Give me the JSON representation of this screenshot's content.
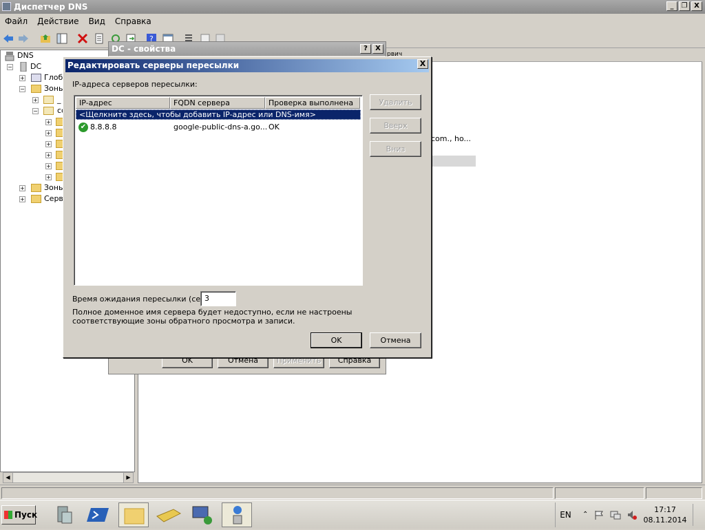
{
  "window": {
    "title": "Диспетчер DNS",
    "min": "_",
    "max": "❐",
    "close": "X"
  },
  "menu": [
    "Файл",
    "Действие",
    "Вид",
    "Справка"
  ],
  "tree": {
    "root": "DNS",
    "server": "DC",
    "items": [
      "Глоба",
      "Зоны",
      "_",
      "co",
      "Зоны",
      "Серве"
    ]
  },
  "right_pane": {
    "partial_text": "com., ho...",
    "header_partial": "рвич"
  },
  "props_dialog": {
    "title": "DC - свойства",
    "help": "?",
    "close": "X",
    "buttons": [
      "OK",
      "Отмена",
      "Применить",
      "Справка"
    ]
  },
  "forwarders_dialog": {
    "title": "Редактировать серверы пересылки",
    "close": "X",
    "list_label": "IP-адреса серверов пересылки:",
    "columns": [
      "IP-адрес",
      "FQDN сервера",
      "Проверка выполнена"
    ],
    "add_prompt": "<Щелкните здесь, чтобы добавить IP-адрес или DNS-имя>",
    "rows": [
      {
        "ip": "8.8.8.8",
        "fqdn": "google-public-dns-a.go...",
        "status": "OK"
      }
    ],
    "side_buttons": [
      "Удалить",
      "Вверх",
      "Вниз"
    ],
    "timeout_label": "Время ожидания пересылки (сек):",
    "timeout_value": "3",
    "note": "Полное доменное имя сервера будет недоступно, если не настроены соответствующие зоны обратного просмотра и записи.",
    "ok": "OK",
    "cancel": "Отмена"
  },
  "taskbar": {
    "start": "Пуск",
    "lang": "EN",
    "time": "17:17",
    "date": "08.11.2014"
  }
}
